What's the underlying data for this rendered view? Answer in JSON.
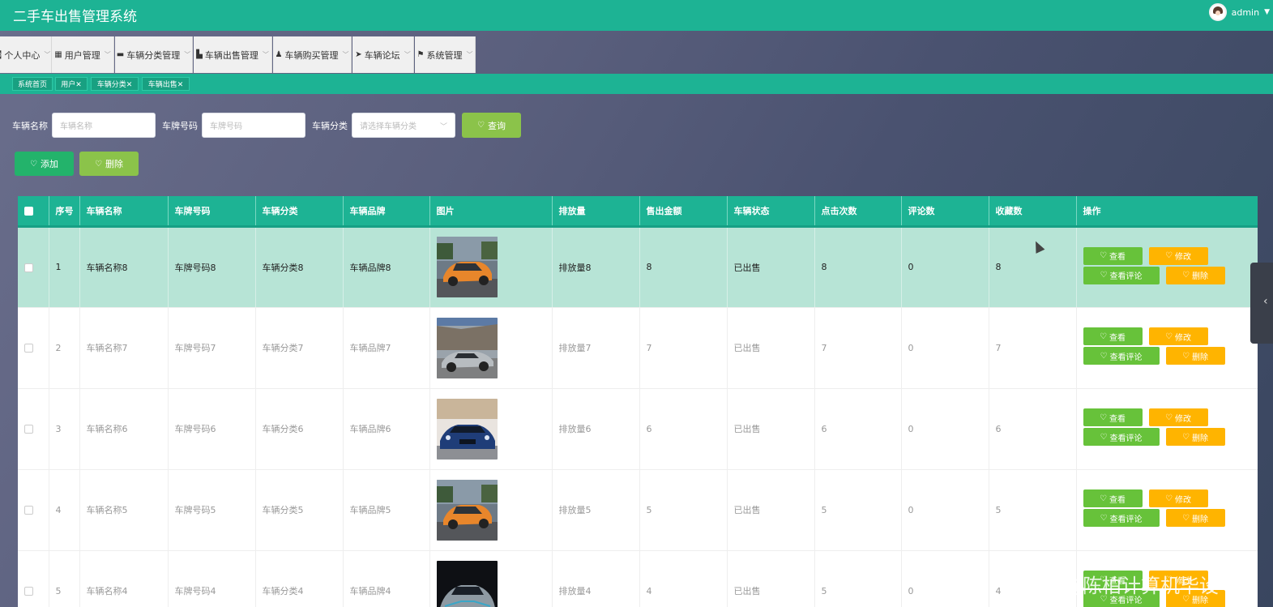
{
  "app": {
    "title": "二手车出售管理系统",
    "username": "admin"
  },
  "menu": [
    {
      "label": "个人中心",
      "icon": "user-circle-icon"
    },
    {
      "label": "用户管理",
      "icon": "grid-icon"
    },
    {
      "label": "车辆分类管理",
      "icon": "monitor-icon"
    },
    {
      "label": "车辆出售管理",
      "icon": "thumbs-up-icon"
    },
    {
      "label": "车辆购买管理",
      "icon": "person-icon"
    },
    {
      "label": "车辆论坛",
      "icon": "send-icon"
    },
    {
      "label": "系统管理",
      "icon": "flag-icon"
    }
  ],
  "tags": [
    {
      "label": "系统首页"
    },
    {
      "label": "用户✕"
    },
    {
      "label": "车辆分类✕"
    },
    {
      "label": "车辆出售✕"
    }
  ],
  "search": {
    "name_label": "车辆名称",
    "name_placeholder": "车辆名称",
    "plate_label": "车牌号码",
    "plate_placeholder": "车牌号码",
    "category_label": "车辆分类",
    "category_placeholder": "请选择车辆分类",
    "query_label": "查询"
  },
  "actions": {
    "add_label": "添加",
    "delete_label": "删除"
  },
  "table": {
    "columns": [
      "序号",
      "车辆名称",
      "车牌号码",
      "车辆分类",
      "车辆品牌",
      "图片",
      "排放量",
      "售出金额",
      "车辆状态",
      "点击次数",
      "评论数",
      "收藏数",
      "操作"
    ],
    "op_labels": {
      "view": "查看",
      "edit": "修改",
      "comments": "查看评论",
      "delete": "删除"
    },
    "rows": [
      {
        "no": "1",
        "name": "车辆名称8",
        "plate": "车牌号码8",
        "category": "车辆分类8",
        "brand": "车辆品牌8",
        "image": "orange-coupe",
        "emission": "排放量8",
        "price": "8",
        "status": "已出售",
        "clicks": "8",
        "comments": "0",
        "favorites": "8"
      },
      {
        "no": "2",
        "name": "车辆名称7",
        "plate": "车牌号码7",
        "category": "车辆分类7",
        "brand": "车辆品牌7",
        "image": "silver-sportscar",
        "emission": "排放量7",
        "price": "7",
        "status": "已出售",
        "clicks": "7",
        "comments": "0",
        "favorites": "7"
      },
      {
        "no": "3",
        "name": "车辆名称6",
        "plate": "车牌号码6",
        "category": "车辆分类6",
        "brand": "车辆品牌6",
        "image": "blue-sedan",
        "emission": "排放量6",
        "price": "6",
        "status": "已出售",
        "clicks": "6",
        "comments": "0",
        "favorites": "6"
      },
      {
        "no": "4",
        "name": "车辆名称5",
        "plate": "车牌号码5",
        "category": "车辆分类5",
        "brand": "车辆品牌5",
        "image": "orange-coupe",
        "emission": "排放量5",
        "price": "5",
        "status": "已出售",
        "clicks": "5",
        "comments": "0",
        "favorites": "5"
      },
      {
        "no": "5",
        "name": "车辆名称4",
        "plate": "车牌号码4",
        "category": "车辆分类4",
        "brand": "车辆品牌4",
        "image": "dark-hypercar",
        "emission": "排放量4",
        "price": "4",
        "status": "已出售",
        "clicks": "5",
        "comments": "0",
        "favorites": "4"
      }
    ]
  },
  "watermark": "CSDN @陈柏计算机毕设",
  "colors": {
    "primary": "#1db394",
    "success": "#67c23a",
    "warning": "#ffb400",
    "highlight_row": "#b7e4d6"
  }
}
